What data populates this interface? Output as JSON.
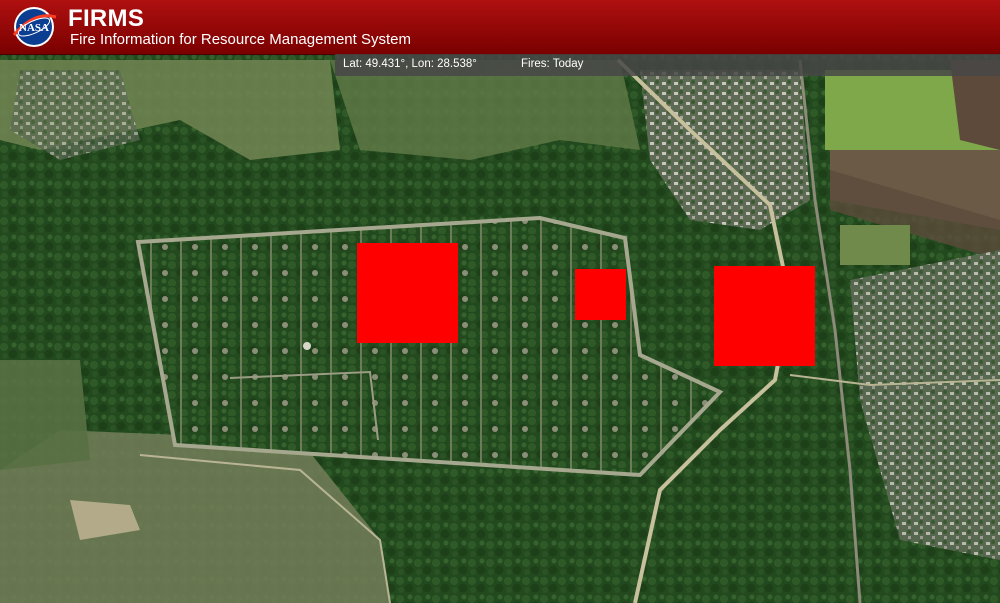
{
  "header": {
    "logo_text": "NASA",
    "title": "FIRMS",
    "subtitle": "Fire Information for Resource Management System"
  },
  "infobar": {
    "coordinates": "Lat: 49.431°, Lon: 28.538°",
    "fires_filter": "Fires: Today"
  },
  "map": {
    "view": "satellite",
    "fire_color": "#ff0000",
    "fire_detections_count": 3
  }
}
